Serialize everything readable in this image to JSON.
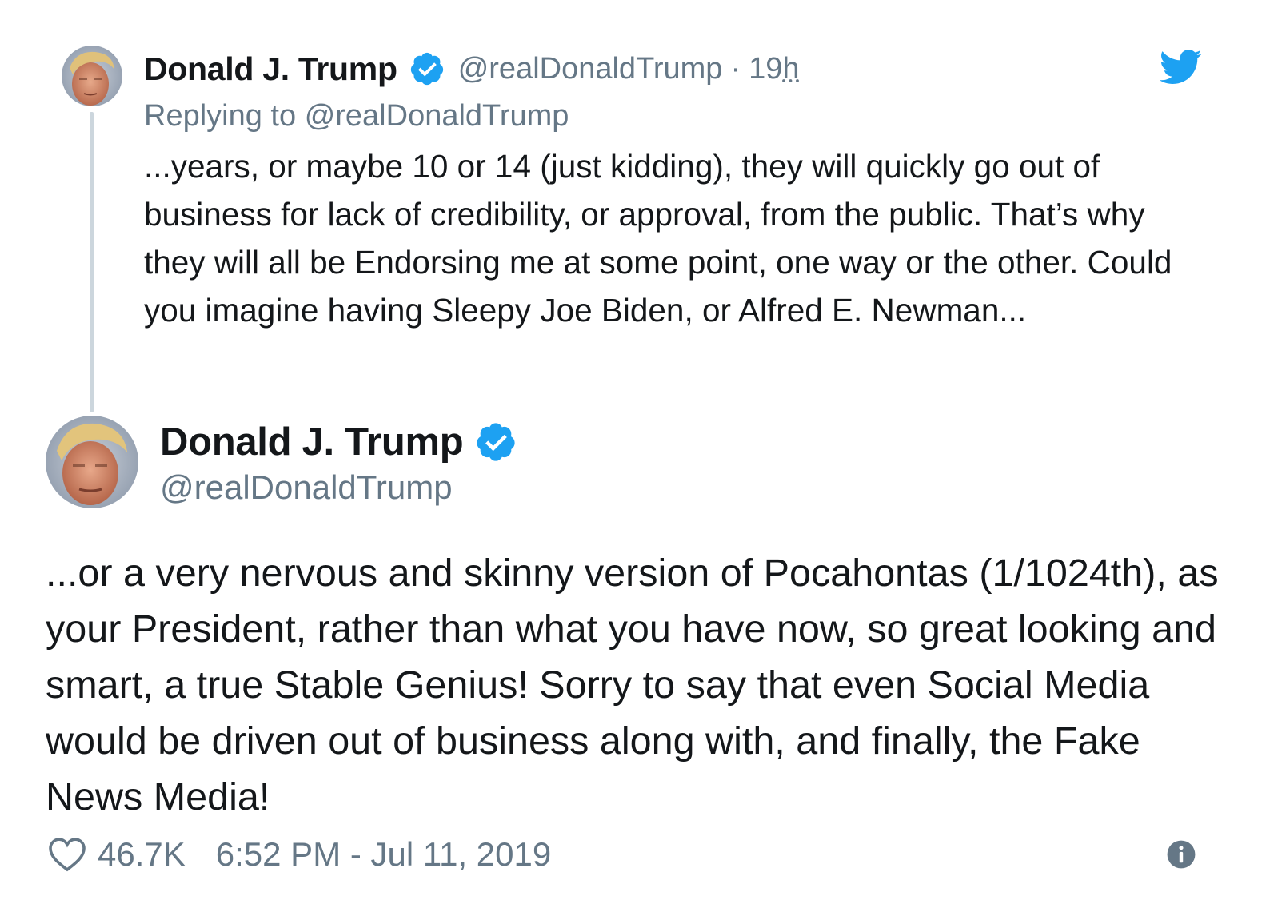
{
  "parent_tweet": {
    "author_name": "Donald J. Trump",
    "handle": "@realDonaldTrump",
    "separator": "·",
    "time_ago": "19",
    "time_ago_unit": "h",
    "replying_to_label": "Replying to",
    "replying_to_handle": "@realDonaldTrump",
    "text": "...years, or maybe 10 or 14 (just kidding), they will quickly go out of business for lack of credibility, or approval, from the public. That’s why they will all be Endorsing me at some point, one way or the other. Could you imagine having Sleepy Joe Biden, or Alfred E. Newman...",
    "verified_icon": "verified-badge-icon",
    "avatar_icon": "avatar-photo"
  },
  "main_tweet": {
    "author_name": "Donald J. Trump",
    "handle": "@realDonaldTrump",
    "text": "...or a very nervous and skinny version of Pocahontas (1/1024th), as your President, rather than what you have now, so great looking and smart, a true Stable Genius! Sorry to say that even Social Media would be driven out of business along with, and finally, the Fake News Media!",
    "verified_icon": "verified-badge-icon",
    "avatar_icon": "avatar-photo"
  },
  "footer": {
    "like_icon": "heart-icon",
    "like_count": "46.7K",
    "timestamp": "6:52 PM - Jul 11, 2019",
    "info_icon": "info-icon"
  },
  "brand": {
    "logo_icon": "twitter-bird-icon",
    "accent_color": "#1da1f2",
    "text_color": "#14171a",
    "secondary_text_color": "#657786",
    "thread_line_color": "#ccd6dd"
  }
}
